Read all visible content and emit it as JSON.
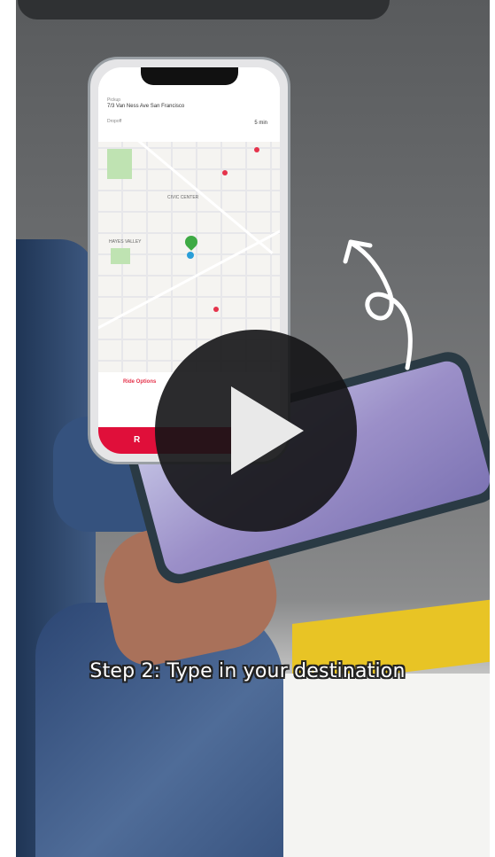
{
  "caption": {
    "text": "Step 2: Type in your destination"
  },
  "phone_app": {
    "pickup_label": "Pickup",
    "pickup_address": "7/3 Van Ness Ave San Francisco",
    "eta": "5 min",
    "dropoff_label": "Dropoff",
    "map_label_civic": "CIVIC CENTER",
    "map_label_hayes": "HAYES VALLEY",
    "ride_options": "Ride Options",
    "cta_label": "R"
  },
  "colors": {
    "brand_red": "#e00f3a",
    "pin_green": "#3eaa44",
    "location_blue": "#2a9ed8",
    "play_bg": "#141416"
  },
  "icons": {
    "play": "play-icon",
    "arrow": "curved-arrow-icon",
    "pin": "map-pin-icon"
  }
}
